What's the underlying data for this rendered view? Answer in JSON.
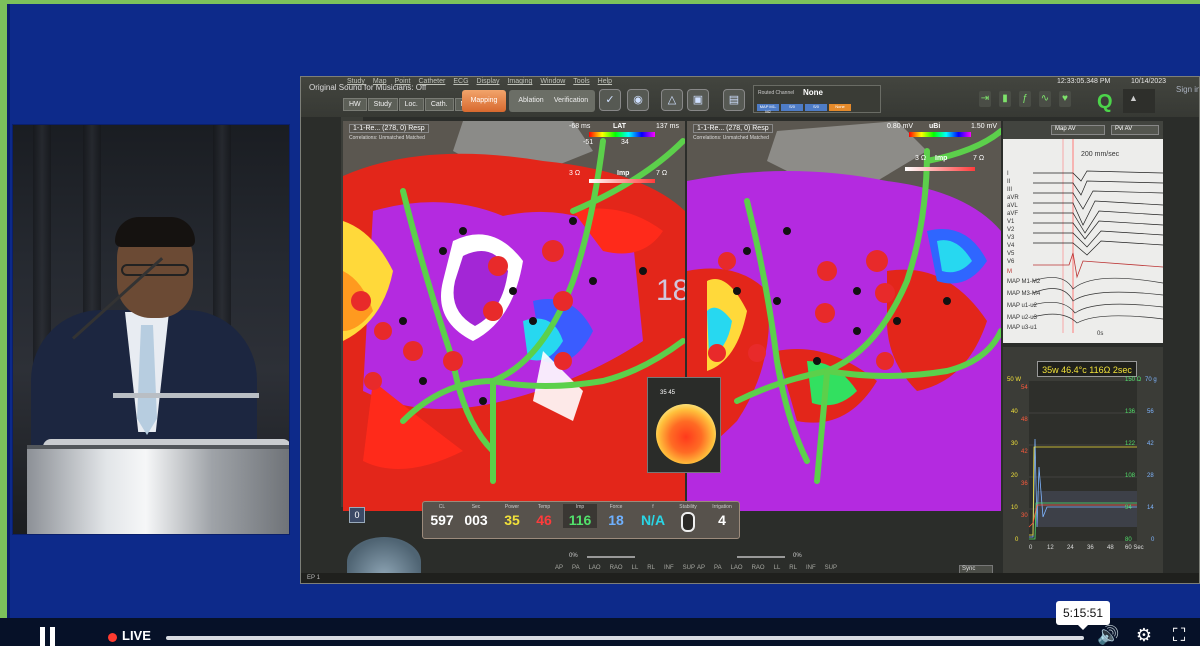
{
  "player": {
    "live_label": "LIVE",
    "timestamp": "5:15:51",
    "icons": [
      "pause-icon",
      "volume-icon",
      "gear-icon",
      "fullscreen-icon"
    ]
  },
  "screen": {
    "app_status": "Original Sound for Musicians: Off",
    "menus": [
      "Study",
      "Map",
      "Point",
      "Catheter",
      "ECG",
      "Display",
      "Imaging",
      "Window",
      "Tools",
      "Help"
    ],
    "clock": "12:33:05.348 PM",
    "date": "10/14/2023",
    "sign_in": "Sign in",
    "seg_tabs": [
      "HW",
      "Study",
      "Loc.",
      "Cath.",
      "Map"
    ],
    "workflow_tabs": {
      "mapping": "Mapping",
      "ablation": "Ablation",
      "verification": "Verification"
    },
    "routed_channel": {
      "label": "Routed Channel",
      "value": "None",
      "pills": [
        "MAP M1-M2",
        "S/0",
        "S/0",
        "None"
      ]
    },
    "ep_label": "EP 1"
  },
  "map_left": {
    "selector": "1-1-Re... (278, 0) Resp",
    "correlations": "Correlations: Unmatched Matched",
    "lat_label": "LAT",
    "lat_min": "-68 ms",
    "lat_max": "137 ms",
    "lat_low_val": "-51",
    "lat_high_val": "34",
    "imp_label": "Imp",
    "imp_min": "3 Ω",
    "imp_max": "7 Ω",
    "point_count": "18",
    "zoom_value": "16"
  },
  "map_right": {
    "selector": "1-1-Re... (278, 0) Resp",
    "correlations": "Correlations: Unmatched Matched",
    "ubi_label": "uBi",
    "ubi_min": "0.80 mV",
    "ubi_max": "1.50 mV",
    "imp_label": "Imp",
    "imp_min": "3 Ω",
    "imp_max": "7 Ω"
  },
  "ecg": {
    "select_1": "Map AV",
    "select_2": "Pvl AV",
    "speed": "200 mm/sec",
    "leads": [
      "I",
      "II",
      "III",
      "aVR",
      "aVL",
      "aVF",
      "V1",
      "V2",
      "V3",
      "V4",
      "V5",
      "V6"
    ],
    "map_leads": [
      "M",
      "MAP M1-M2",
      "MAP M3-M4",
      "MAP u1-u2",
      "MAP u2-u3",
      "MAP u3-u1"
    ],
    "time_mark": "0s"
  },
  "ablation_graph": {
    "readout": "35w 46.4°c 116Ω 2sec",
    "y_left_w": [
      "50 W",
      "40",
      "30",
      "20",
      "10",
      "0"
    ],
    "y_left_t": [
      "54",
      "48",
      "42",
      "36",
      "30"
    ],
    "y_right_ohm": [
      "150 Ω",
      "136",
      "122",
      "108",
      "94",
      "80"
    ],
    "y_right_g": [
      "70 g",
      "56",
      "42",
      "28",
      "14",
      "0"
    ],
    "x_ticks": [
      "0",
      "12",
      "24",
      "36",
      "48",
      "60 Sec"
    ],
    "colors": {
      "power": "#f2e23a",
      "temp": "#ff5a3c",
      "impedance": "#52e06b",
      "force": "#7fb5ff"
    }
  },
  "contact": {
    "values": "35 45"
  },
  "indicators": {
    "cl": {
      "name": "CL",
      "value": "597",
      "color": "#ffffff"
    },
    "sec": {
      "name": "Sec",
      "value": "003",
      "color": "#ffffff"
    },
    "power": {
      "name": "Power",
      "value": "35",
      "color": "#f2e23a"
    },
    "temp": {
      "name": "Temp",
      "value": "46",
      "color": "#ff3b3b"
    },
    "imp": {
      "name": "Imp",
      "value": "116",
      "color": "#52e06b"
    },
    "force": {
      "name": "Force",
      "value": "18",
      "color": "#6fb1ff"
    },
    "fti": {
      "name": "f",
      "value": "N/A",
      "color": "#2ad6e6"
    },
    "stability": {
      "name": "Stability",
      "value": ""
    },
    "irrigation": {
      "name": "Irrigation",
      "value": "4",
      "color": "#ffffff"
    }
  },
  "view_controls": {
    "left_pct": "0%",
    "right_pct": "0%",
    "views_left": [
      "AP",
      "PA",
      "LAO",
      "RAO",
      "LL",
      "RL",
      "INF",
      "SUP"
    ],
    "views_right": [
      "AP",
      "PA",
      "LAO",
      "RAO",
      "LL",
      "RL",
      "INF",
      "SUP"
    ],
    "sync": "Sync",
    "left_zero": "0"
  }
}
